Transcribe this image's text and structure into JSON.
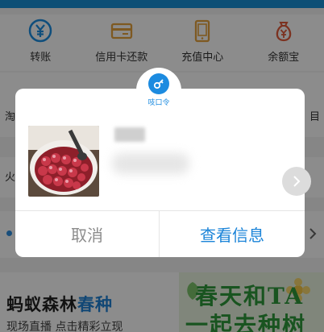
{
  "grid": {
    "row1": [
      {
        "label": "转账",
        "icon": "yen-circle-icon"
      },
      {
        "label": "信用卡还款",
        "icon": "credit-card-icon"
      },
      {
        "label": "充值中心",
        "icon": "phone-icon"
      },
      {
        "label": "余额宝",
        "icon": "money-bag-icon"
      }
    ],
    "row2_left_partial": "淘",
    "row2_right_partial": "目",
    "row3_left_partial": "火"
  },
  "modal": {
    "badge_label": "吱口令",
    "badge_icon": "key-icon",
    "photo": "onion-bowl-photo",
    "cancel_label": "取消",
    "view_label": "查看信息",
    "next_icon": "chevron-right-icon"
  },
  "forest": {
    "title_main": "蚂蚁森林",
    "title_accent": "春种",
    "subtitle": "现场直播 点击精彩立现",
    "promo_line1": "春天和TA",
    "promo_line2": "一起去种树"
  },
  "colors": {
    "brand_blue": "#1c8be0",
    "accent_blue": "#1f82d6",
    "promo_green": "#2f9a3b"
  }
}
